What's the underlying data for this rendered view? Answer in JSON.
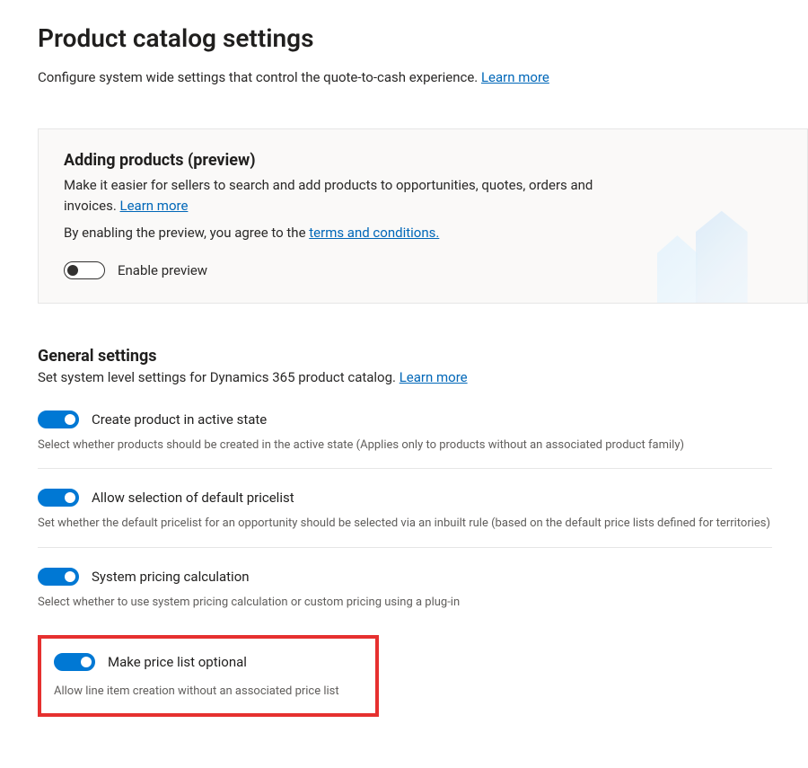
{
  "header": {
    "title": "Product catalog settings",
    "subtitle": "Configure system wide settings that control the quote-to-cash experience. ",
    "learn_more": "Learn more"
  },
  "preview_card": {
    "heading": "Adding products (preview)",
    "body1_a": "Make it easier for sellers to search and add products to opportunities, quotes, orders and invoices. ",
    "body1_link": "Learn more",
    "body2_a": "By enabling the preview, you agree to the ",
    "body2_link": "terms and conditions.",
    "toggle_label": "Enable preview",
    "toggle_state": "off"
  },
  "general": {
    "heading": "General settings",
    "subtitle": "Set system level settings for Dynamics 365 product catalog. ",
    "learn_more": "Learn more",
    "settings": {
      "create_active": {
        "label": "Create product in active state",
        "desc": "Select whether products should be created in the active state (Applies only to products without an associated product family)",
        "state": "on"
      },
      "default_pricelist": {
        "label": "Allow selection of default pricelist",
        "desc": "Set whether the default pricelist for an opportunity should be selected via an inbuilt rule (based on the default price lists defined for territories)",
        "state": "on"
      },
      "system_pricing": {
        "label": "System pricing calculation",
        "desc": "Select whether to use system pricing calculation or custom pricing using a plug-in",
        "state": "on"
      },
      "pricelist_optional": {
        "label": "Make price list optional",
        "desc": "Allow line item creation without an associated price list",
        "state": "on"
      }
    }
  }
}
